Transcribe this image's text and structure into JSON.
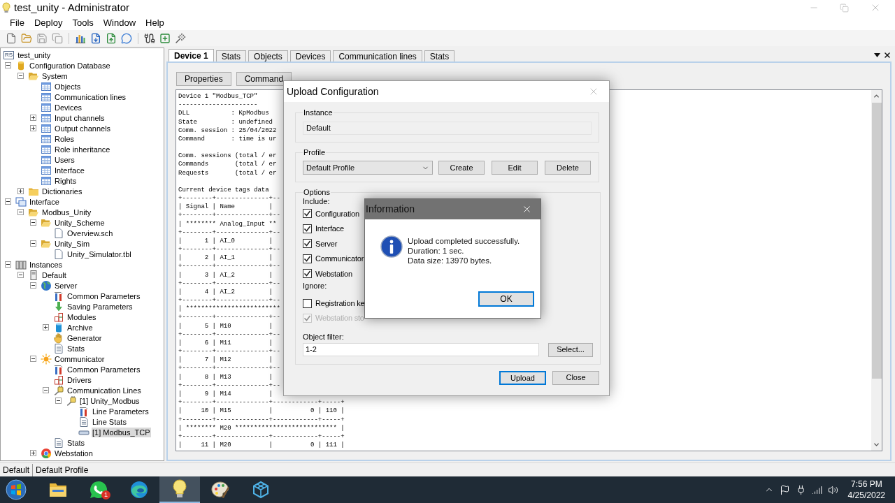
{
  "window": {
    "title": "test_unity - Administrator"
  },
  "menu": [
    "File",
    "Deploy",
    "Tools",
    "Window",
    "Help"
  ],
  "tree": {
    "label": "test_unity",
    "logo_text": "RS",
    "selected": false,
    "children": [
      {
        "label": "Configuration Database",
        "kind": "database",
        "expanded": true,
        "selected": false,
        "children": [
          {
            "label": "System",
            "kind": "folder-open",
            "expanded": true,
            "selected": false,
            "children": [
              {
                "label": "Objects",
                "kind": "table",
                "selected": false
              },
              {
                "label": "Communication lines",
                "kind": "table",
                "selected": false
              },
              {
                "label": "Devices",
                "kind": "table",
                "selected": false
              },
              {
                "label": "Input channels",
                "kind": "table",
                "expanded": false,
                "selected": false
              },
              {
                "label": "Output channels",
                "kind": "table",
                "expanded": false,
                "selected": false
              },
              {
                "label": "Roles",
                "kind": "table",
                "selected": false
              },
              {
                "label": "Role inheritance",
                "kind": "table",
                "selected": false
              },
              {
                "label": "Users",
                "kind": "table",
                "selected": false
              },
              {
                "label": "Interface",
                "kind": "table",
                "selected": false
              },
              {
                "label": "Rights",
                "kind": "table",
                "selected": false
              }
            ]
          },
          {
            "label": "Dictionaries",
            "kind": "folder",
            "expanded": false,
            "selected": false
          }
        ]
      },
      {
        "label": "Interface",
        "kind": "window",
        "expanded": true,
        "selected": false,
        "children": [
          {
            "label": "Modbus_Unity",
            "kind": "folder-open",
            "expanded": true,
            "selected": false,
            "children": [
              {
                "label": "Unity_Scheme",
                "kind": "folder-open",
                "expanded": true,
                "selected": false,
                "children": [
                  {
                    "label": "Overview.sch",
                    "kind": "file",
                    "selected": false
                  }
                ]
              },
              {
                "label": "Unity_Sim",
                "kind": "folder-open",
                "expanded": true,
                "selected": false,
                "children": [
                  {
                    "label": "Unity_Simulator.tbl",
                    "kind": "file",
                    "selected": false
                  }
                ]
              }
            ]
          }
        ]
      },
      {
        "label": "Instances",
        "kind": "instances",
        "expanded": true,
        "selected": false,
        "children": [
          {
            "label": "Default",
            "kind": "server",
            "expanded": true,
            "selected": false,
            "children": [
              {
                "label": "Server",
                "kind": "globe",
                "expanded": true,
                "selected": false,
                "children": [
                  {
                    "label": "Common Parameters",
                    "kind": "tools",
                    "selected": false
                  },
                  {
                    "label": "Saving Parameters",
                    "kind": "arrow-down",
                    "selected": false
                  },
                  {
                    "label": "Modules",
                    "kind": "blocks",
                    "selected": false
                  },
                  {
                    "label": "Archive",
                    "kind": "cylinder",
                    "expanded": false,
                    "selected": false
                  },
                  {
                    "label": "Generator",
                    "kind": "hand",
                    "selected": false
                  },
                  {
                    "label": "Stats",
                    "kind": "doc",
                    "selected": false
                  }
                ]
              },
              {
                "label": "Communicator",
                "kind": "sun",
                "expanded": true,
                "selected": false,
                "children": [
                  {
                    "label": "Common Parameters",
                    "kind": "tools",
                    "selected": false
                  },
                  {
                    "label": "Drivers",
                    "kind": "blocks",
                    "selected": false
                  },
                  {
                    "label": "Communication Lines",
                    "kind": "cable",
                    "expanded": true,
                    "selected": false,
                    "children": [
                      {
                        "label": "[1] Unity_Modbus",
                        "kind": "cable",
                        "expanded": true,
                        "selected": false,
                        "children": [
                          {
                            "label": "Line Parameters",
                            "kind": "tools",
                            "selected": false
                          },
                          {
                            "label": "Line Stats",
                            "kind": "doc",
                            "selected": false
                          },
                          {
                            "label": "[1] Modbus_TCP",
                            "kind": "device",
                            "selected": true
                          }
                        ]
                      }
                    ]
                  },
                  {
                    "label": "Stats",
                    "kind": "doc",
                    "selected": false
                  }
                ]
              },
              {
                "label": "Webstation",
                "kind": "browser",
                "expanded": false,
                "selected": false
              }
            ]
          }
        ]
      }
    ]
  },
  "tabs": [
    {
      "label": "Device 1",
      "selected": true
    },
    {
      "label": "Stats",
      "selected": false
    },
    {
      "label": "Objects",
      "selected": false
    },
    {
      "label": "Devices",
      "selected": false
    },
    {
      "label": "Communication lines",
      "selected": false
    },
    {
      "label": "Stats",
      "selected": false
    }
  ],
  "device_page": {
    "buttons": [
      "Properties",
      "Command"
    ],
    "text_blocks": [
      [
        "Device 1 \"Modbus_TCP\"",
        "---------------------",
        "DLL           : KpModbus",
        "State         : undefined",
        "Comm. session : 25/04/2022",
        "Command       : time is ur"
      ],
      [
        "Comm. sessions (total / er",
        "Commands       (total / er",
        "Requests       (total / er"
      ],
      [
        "Current device tags data",
        "+--------+--------------+--",
        "| Signal | Name         |",
        "+--------+--------------+--",
        "| ******** Analog_Input **",
        "+--------+--------------+--",
        "|      1 | AI_0         |",
        "+--------+--------------+--",
        "|      2 | AI_1         |",
        "+--------+--------------+--",
        "|      3 | AI_2         |",
        "+--------+--------------+--",
        "|      4 | AI_2         |",
        "+--------+--------------+--",
        "| *************************",
        "+--------+--------------+--",
        "|      5 | M10          |",
        "+--------+--------------+--",
        "|      6 | M11          |",
        "+--------+--------------+--",
        "|      7 | M12          |",
        "+--------+--------------+--",
        "|      8 | M13          |",
        "+--------+--------------+--",
        "|      9 | M14          |",
        "+--------+--------------+------------+-----+",
        "|     10 | M15          |          0 | 110 |",
        "+--------+--------------+------------+-----+",
        "| ******** M20 *************************** |",
        "+--------+--------------+------------+-----+",
        "|     11 | M20          |          0 | 111 |"
      ]
    ]
  },
  "upload_dialog": {
    "title": "Upload Configuration",
    "instance": {
      "label": "Instance",
      "value": "Default"
    },
    "profile": {
      "label": "Profile",
      "value": "Default Profile",
      "buttons": [
        "Create",
        "Edit",
        "Delete"
      ]
    },
    "options": {
      "label": "Options",
      "include_label": "Include:",
      "include": [
        {
          "label": "Configuration",
          "checked": true,
          "disabled": false
        },
        {
          "label": "Interface",
          "checked": true,
          "disabled": false
        },
        {
          "label": "Server",
          "checked": true,
          "disabled": false
        },
        {
          "label": "Communicator",
          "checked": true,
          "disabled": false
        },
        {
          "label": "Webstation",
          "checked": true,
          "disabled": false
        }
      ],
      "ignore_label": "Ignore:",
      "ignore": [
        {
          "label": "Registration ke",
          "checked": false,
          "disabled": false
        },
        {
          "label": "Webstation sto",
          "checked": true,
          "disabled": true
        }
      ],
      "object_filter": {
        "label": "Object filter:",
        "value": "1-2",
        "button": "Select..."
      }
    },
    "buttons": [
      {
        "label": "Upload",
        "default": true
      },
      {
        "label": "Close",
        "default": false
      }
    ]
  },
  "info_dialog": {
    "title": "Information",
    "lines": [
      "Upload completed successfully.",
      "Duration: 1 sec.",
      "Data size: 13970 bytes."
    ],
    "button": "OK"
  },
  "status_bar": [
    "Default",
    "Default Profile"
  ],
  "taskbar": {
    "apps": [
      {
        "kind": "folder",
        "active": false
      },
      {
        "kind": "chat",
        "active": false,
        "badge": "1"
      },
      {
        "kind": "browser",
        "active": false
      },
      {
        "kind": "bulb",
        "active": true
      },
      {
        "kind": "palette",
        "active": false
      },
      {
        "kind": "cube",
        "active": false
      }
    ],
    "time": "7:56 PM",
    "date": "4/25/2022"
  }
}
